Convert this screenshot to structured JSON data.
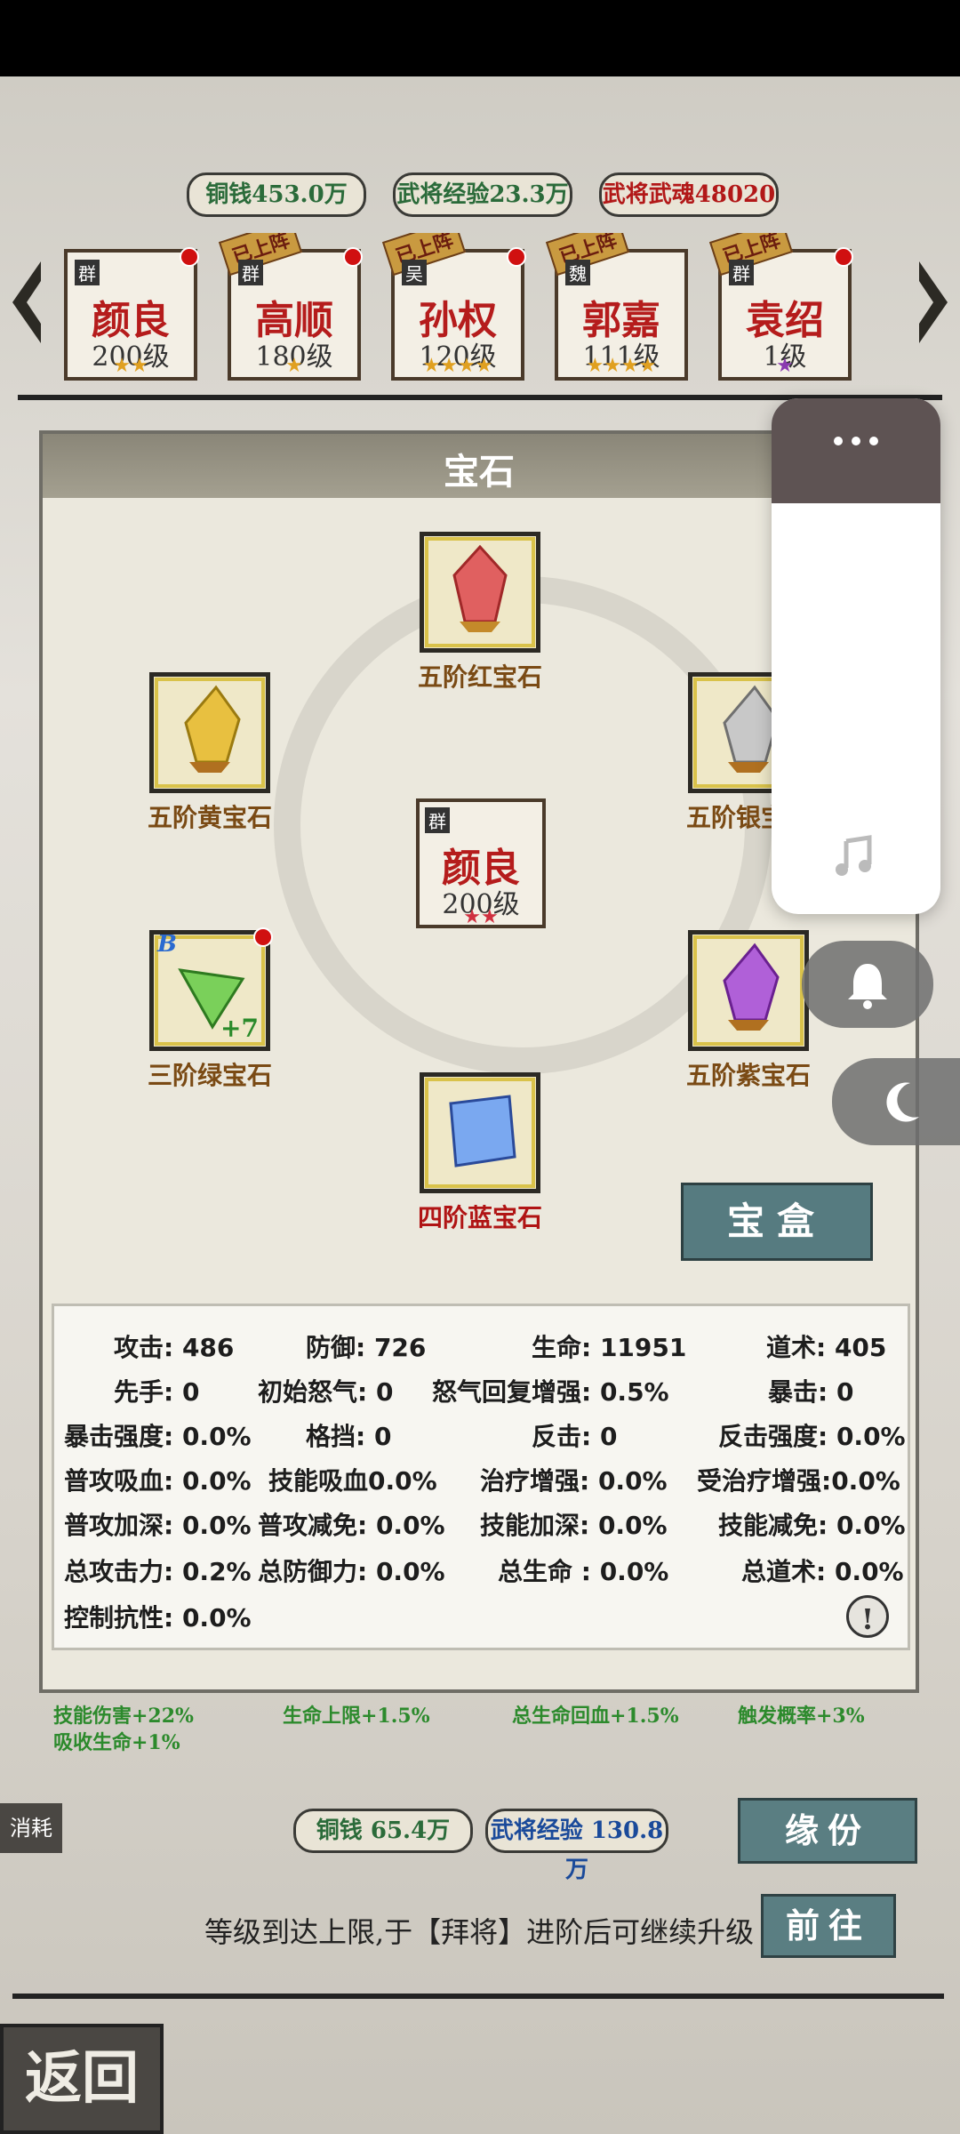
{
  "currency": {
    "copper": "铜钱453.0万",
    "exp": "武将经验23.3万",
    "soul": "武将武魂48020"
  },
  "heroes": [
    {
      "badge": "已上阵",
      "faction": "群",
      "name": "颜良",
      "level": "200级",
      "stars": "★★"
    },
    {
      "badge": "已上阵",
      "faction": "群",
      "name": "高顺",
      "level": "180级",
      "stars": "★"
    },
    {
      "badge": "已上阵",
      "faction": "吴",
      "name": "孙权",
      "level": "120级",
      "stars": "★★★★"
    },
    {
      "badge": "已上阵",
      "faction": "魏",
      "name": "郭嘉",
      "level": "111级",
      "stars": "★★★★"
    },
    {
      "badge": "已上阵",
      "faction": "群",
      "name": "袁绍",
      "level": "1级",
      "stars": "★"
    }
  ],
  "panel": {
    "title": "宝石",
    "gems": {
      "top": "五阶红宝石",
      "left_top": "五阶黄宝石",
      "right_top": "五阶银宝石",
      "left_bottom": "三阶绿宝石",
      "left_bottom_badge": "+7",
      "left_bottom_tier": "B",
      "right_bottom": "五阶紫宝石",
      "bottom": "四阶蓝宝石"
    },
    "center_hero": {
      "faction": "群",
      "name": "颜良",
      "level": "200级",
      "stars": "★★"
    },
    "treasure_button": "宝盒"
  },
  "stats": {
    "attack": "攻击: 486",
    "defense": "防御: 726",
    "hp": "生命: 11951",
    "taoism": "道术: 405",
    "initiative": "先手: 0",
    "initial_rage": "初始怒气: 0",
    "rage_regen": "怒气回复增强: 0.5%",
    "crit": "暴击: 0",
    "crit_power": "暴击强度: 0.0%",
    "block": "格挡: 0",
    "counter": "反击: 0",
    "counter_power": "反击强度: 0.0%",
    "normal_lifesteal": "普攻吸血: 0.0%",
    "skill_lifesteal": "技能吸血0.0%",
    "heal_boost": "治疗增强: 0.0%",
    "heal_received": "受治疗增强:0.0%",
    "normal_amp": "普攻加深: 0.0%",
    "normal_reduce": "普攻减免: 0.0%",
    "skill_amp": "技能加深: 0.0%",
    "skill_reduce": "技能减免: 0.0%",
    "total_attack": "总攻击力: 0.2%",
    "total_defense": "总防御力: 0.0%",
    "total_hp": "总生命 : 0.0%",
    "total_taoism": "总道术: 0.0%",
    "control_resist": "控制抗性: 0.0%"
  },
  "bonuses": {
    "b1": "技能伤害+22%",
    "b2": "吸收生命+1%",
    "b3": "生命上限+1.5%",
    "b4": "总生命回血+1.5%",
    "b5": "触发概率+3%"
  },
  "bottom": {
    "consume_label": "消耗",
    "cost_copper": "铜钱 65.4万",
    "cost_exp": "武将经验 130.8万",
    "fate_button": "缘份",
    "hint": "等级到达上限,于【拜将】进阶后可继续升级",
    "goto_button": "前往",
    "back_button": "返回"
  },
  "colors": {
    "accent": "#567b80",
    "hero_name": "#b51c1c",
    "stat_green": "#2c8a2c"
  }
}
